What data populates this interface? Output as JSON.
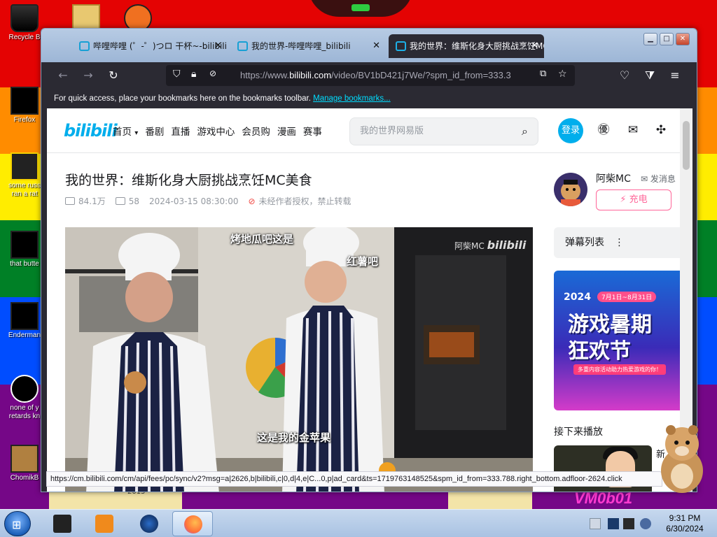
{
  "desktop": {
    "icons": [
      {
        "label": "Recycle B"
      },
      {
        "label": "Firefox"
      },
      {
        "label": "some russ ran a rat"
      },
      {
        "label": "that butte"
      },
      {
        "label": "Enderman"
      },
      {
        "label": "none of y retards kn"
      },
      {
        "label": "ChomikB"
      }
    ],
    "watermark": "VM0b01",
    "stray_number": "2015"
  },
  "browser": {
    "tabs": [
      {
        "title": "哔哩哔哩 (゜-゜)つロ 干杯~-bilibili",
        "active": false
      },
      {
        "title": "我的世界-哔哩哔哩_bilibili",
        "active": false
      },
      {
        "title": "我的世界：维斯化身大厨挑战烹饪MC美食",
        "active": true
      }
    ],
    "url": {
      "prefix": "https://www.",
      "domain": "bilibili.com",
      "path": "/video/BV1bD421j7We/?spm_id_from=333.3"
    },
    "bookmarks_bar": {
      "text": "For quick access, place your bookmarks here on the bookmarks toolbar.",
      "link": "Manage bookmarks..."
    },
    "status_url": "https://cm.bilibili.com/cm/api/fees/pc/sync/v2?msg=a|2626,b|bilibili,c|0,d|4,e|C...0,p|ad_card&ts=1719763148525&spm_id_from=333.788.right_bottom.adfloor-2624.click"
  },
  "site": {
    "logo": "bilibili",
    "nav": [
      "首页",
      "番剧",
      "直播",
      "游戏中心",
      "会员购",
      "漫画",
      "赛事"
    ],
    "search_placeholder": "我的世界网易版",
    "login": "登录"
  },
  "video": {
    "title": "我的世界：维斯化身大厨挑战烹饪MC美食",
    "views": "84.1万",
    "danmaku_count": "58",
    "date": "2024-03-15 08:30:00",
    "notice": "未经作者授权，禁止转载",
    "subtitles": {
      "top1": "烤地瓜吧这是",
      "top2": "红薯吧",
      "bottom": "这是我的金苹果"
    },
    "watermark_user": "阿柴MC",
    "watermark_brand": "bilibili"
  },
  "uploader": {
    "name": "阿柴MC",
    "message": "发消息",
    "charge": "充电"
  },
  "sidebar": {
    "danmaku_list": "弹幕列表",
    "ad": {
      "year": "2024",
      "dates": "7月1日~8月31日",
      "line1": "游戏暑期",
      "line2": "狂欢节",
      "tagline": "多重内容活动助力热爱游戏的你！"
    },
    "up_next": "接下来播放",
    "next_text": "新"
  },
  "taskbar": {
    "time": "9:31 PM",
    "date": "6/30/2024"
  }
}
